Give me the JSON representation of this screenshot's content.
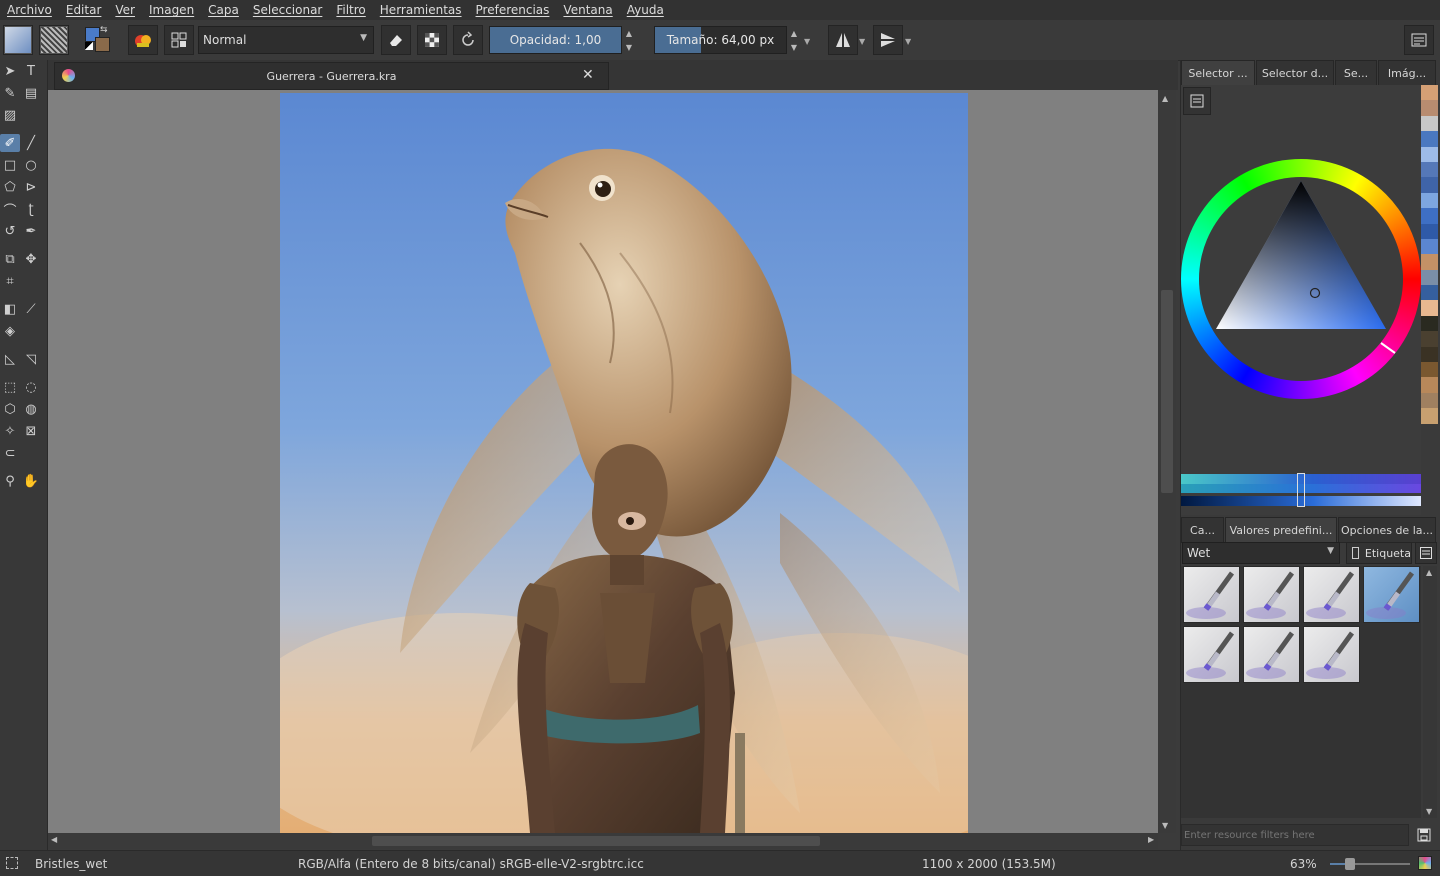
{
  "menu": [
    "Archivo",
    "Editar",
    "Ver",
    "Imagen",
    "Capa",
    "Seleccionar",
    "Filtro",
    "Herramientas",
    "Preferencias",
    "Ventana",
    "Ayuda"
  ],
  "toolbar": {
    "blend_mode": "Normal",
    "opacity_label": "Opacidad:",
    "opacity_value": "1,00",
    "opacity_fraction": 1.0,
    "size_label": "Tamaño:",
    "size_value": "64,00 px",
    "size_fraction": 0.35
  },
  "document": {
    "tab_title": "Guerrera - Guerrera.kra"
  },
  "docker_tabs_top": [
    "Selector ...",
    "Selector d...",
    "Se...",
    "Imág..."
  ],
  "docker_tabs_bottom": [
    "Ca...",
    "Valores predefini...",
    "Opciones de la..."
  ],
  "presets": {
    "filter_value": "Wet",
    "tag_label": "Etiqueta",
    "search_placeholder": "Enter resource filters here",
    "count": 7,
    "selected_index": 3
  },
  "palette_colors": [
    "#d5a075",
    "#b88c70",
    "#c8c8c8",
    "#4a78c0",
    "#9dbbe8",
    "#5578b8",
    "#3f64a8",
    "#7da6e0",
    "#3e6fc4",
    "#2f5aa8",
    "#5b86d0",
    "#c49166",
    "#7a8ea8",
    "#355f9e",
    "#e8b890",
    "#2a2a20",
    "#4a4030",
    "#3a3224",
    "#7a5830",
    "#b8885a",
    "#a08060",
    "#c8a070"
  ],
  "status": {
    "preset_name": "Bristles_wet",
    "color_space": "RGB/Alfa (Entero de 8 bits/canal)  sRGB-elle-V2-srgbtrc.icc",
    "image_size": "1100 x 2000 (153.5M)",
    "zoom": "63%"
  },
  "colors": {
    "accent": "#5a7fa8",
    "foreground_color": "#4a7bc8",
    "background_color": "#8a6a4a"
  }
}
